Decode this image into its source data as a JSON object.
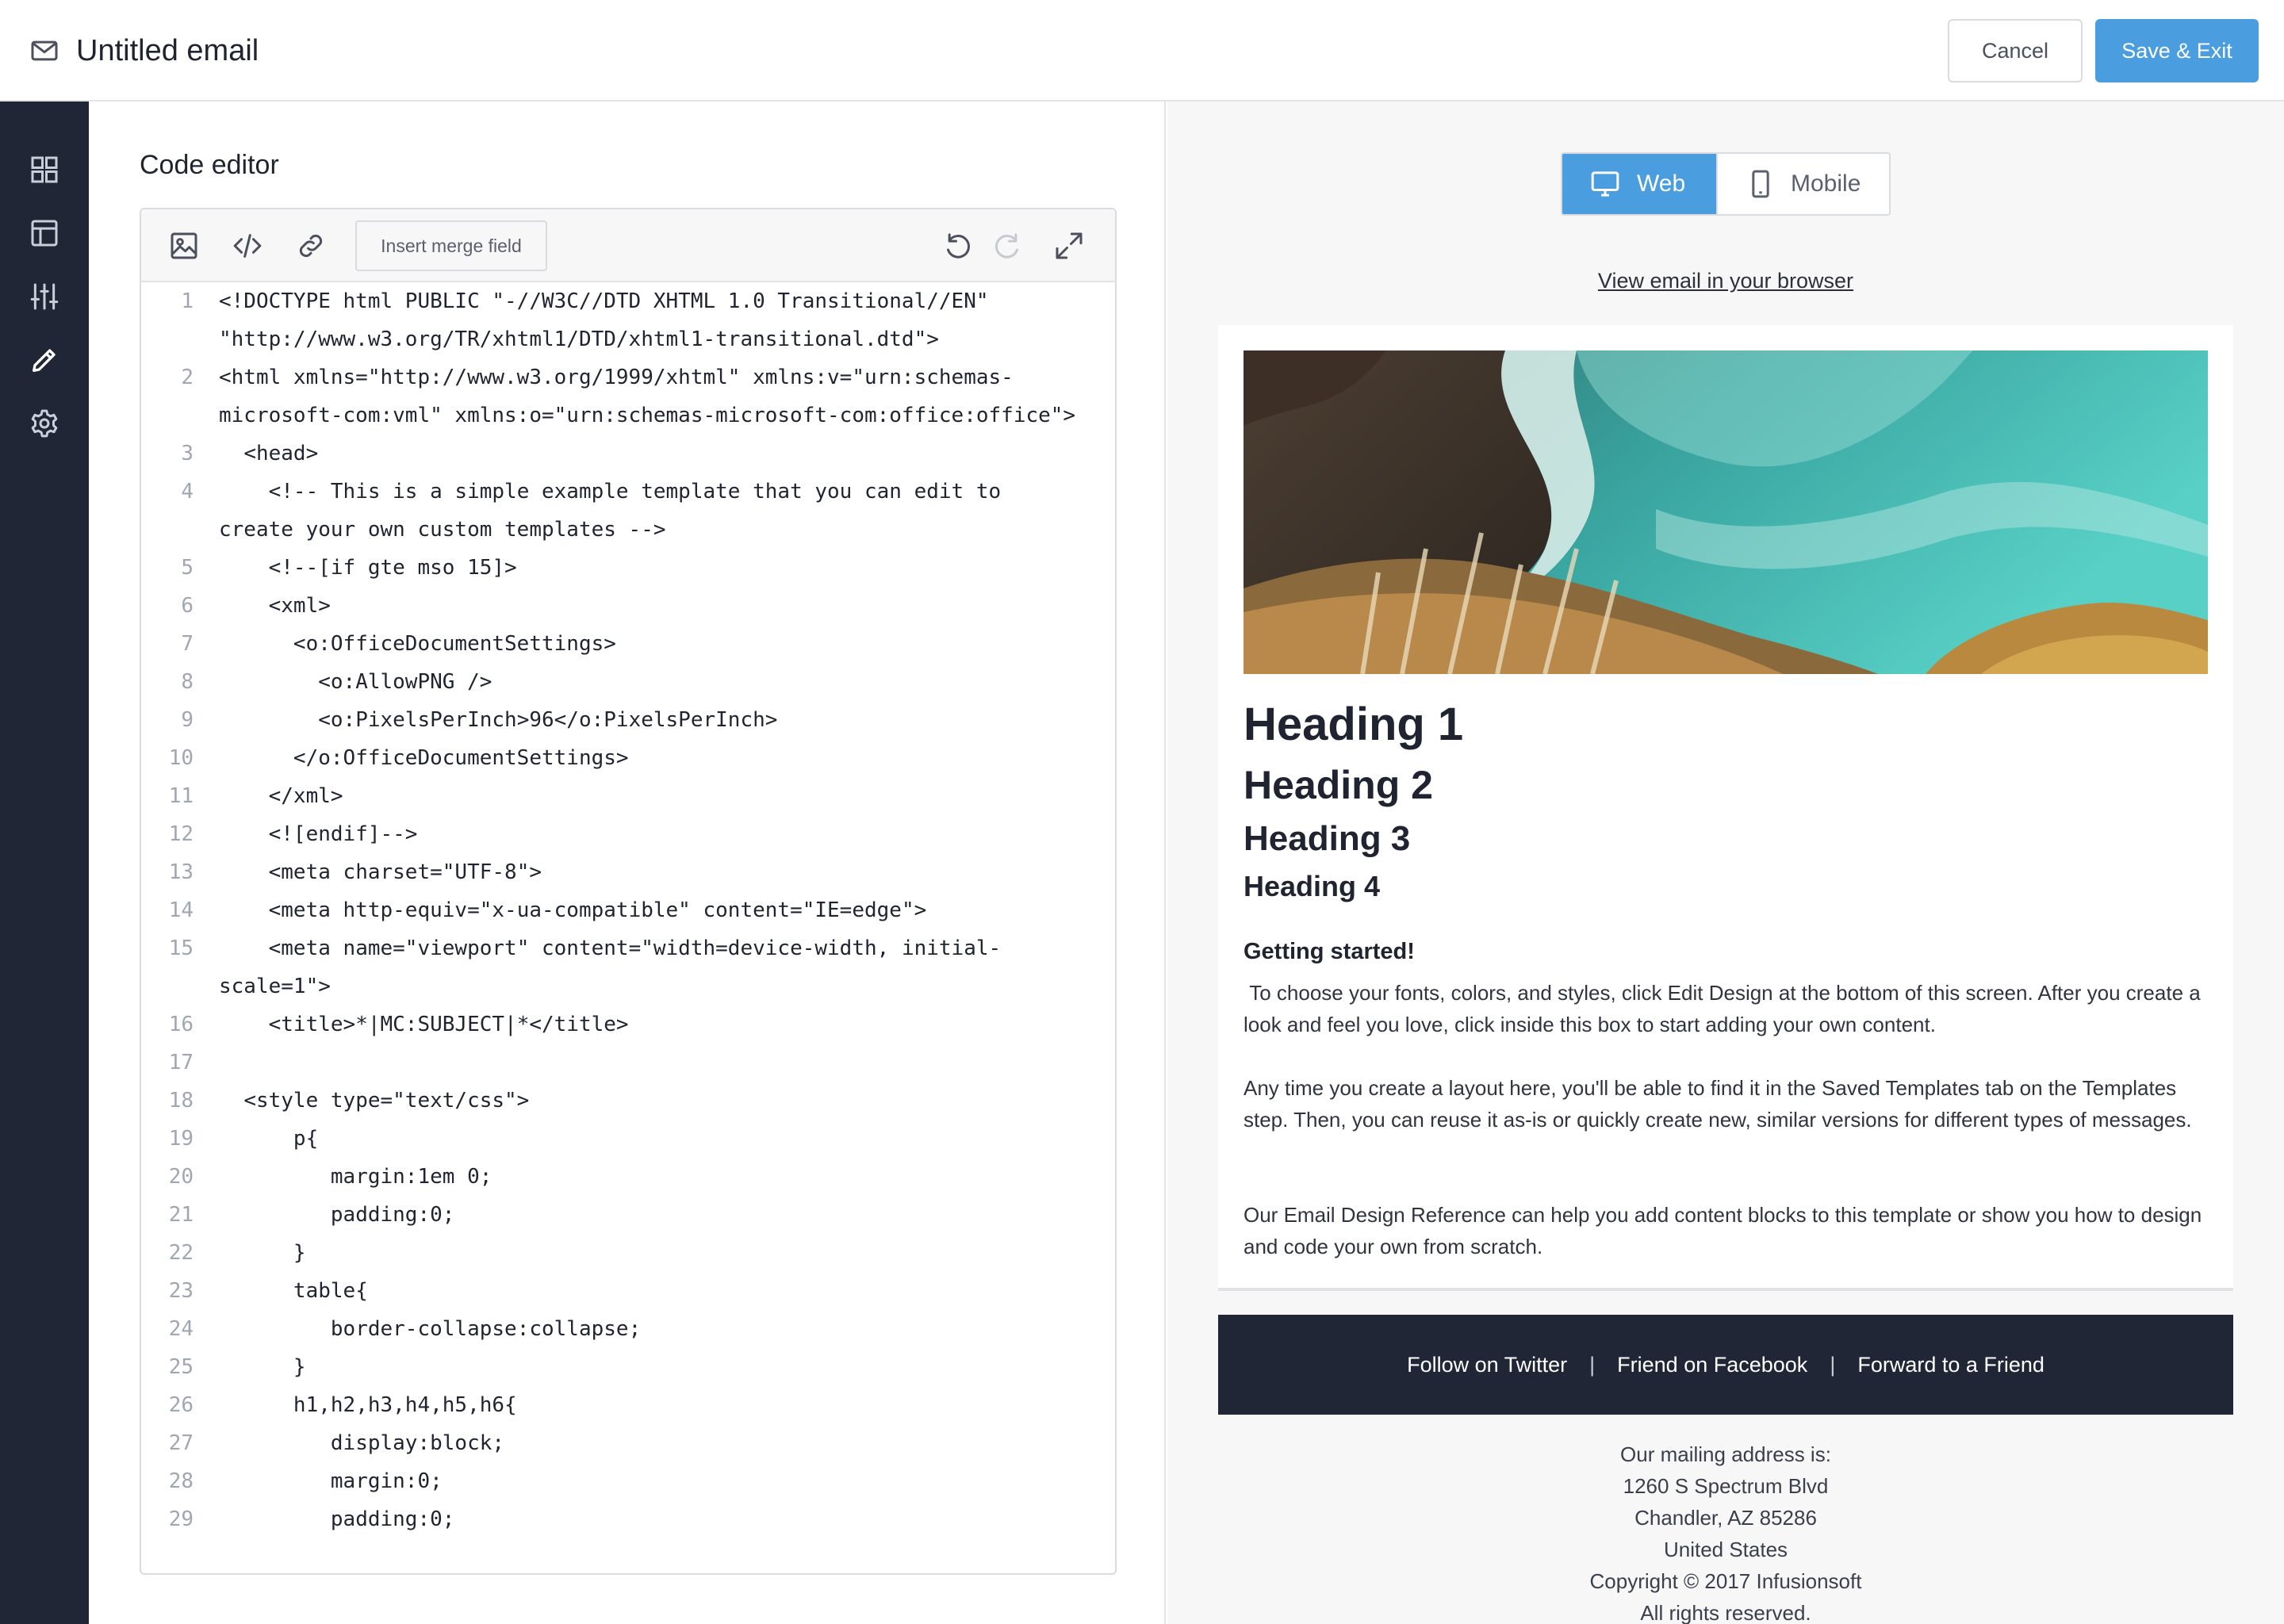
{
  "header": {
    "title": "Untitled email",
    "cancel_label": "Cancel",
    "save_label": "Save & Exit"
  },
  "sidebar": {
    "items": [
      {
        "icon": "grid-icon"
      },
      {
        "icon": "layout-icon"
      },
      {
        "icon": "sliders-icon"
      },
      {
        "icon": "pencil-icon",
        "active": true
      },
      {
        "icon": "gear-icon"
      }
    ]
  },
  "editor": {
    "title": "Code editor",
    "toolbar": {
      "merge_field_label": "Insert merge field",
      "icons": [
        "image-icon",
        "code-icon",
        "link-icon",
        "undo-icon",
        "redo-icon",
        "expand-icon"
      ]
    },
    "lines": [
      {
        "n": "1",
        "t": "<!DOCTYPE html PUBLIC \"-//W3C//DTD XHTML 1.0 Transitional//EN\" \"http://www.w3.org/TR/xhtml1/DTD/xhtml1-transitional.dtd\">"
      },
      {
        "n": "2",
        "t": "<html xmlns=\"http://www.w3.org/1999/xhtml\" xmlns:v=\"urn:schemas-microsoft-com:vml\" xmlns:o=\"urn:schemas-microsoft-com:office:office\">"
      },
      {
        "n": "3",
        "t": "  <head>"
      },
      {
        "n": "4",
        "t": "    <!-- This is a simple example template that you can edit to create your own custom templates -->"
      },
      {
        "n": "5",
        "t": "    <!--[if gte mso 15]>"
      },
      {
        "n": "6",
        "t": "    <xml>"
      },
      {
        "n": "7",
        "t": "      <o:OfficeDocumentSettings>"
      },
      {
        "n": "8",
        "t": "        <o:AllowPNG />"
      },
      {
        "n": "9",
        "t": "        <o:PixelsPerInch>96</o:PixelsPerInch>"
      },
      {
        "n": "10",
        "t": "      </o:OfficeDocumentSettings>"
      },
      {
        "n": "11",
        "t": "    </xml>"
      },
      {
        "n": "12",
        "t": "    <![endif]-->"
      },
      {
        "n": "13",
        "t": "    <meta charset=\"UTF-8\">"
      },
      {
        "n": "14",
        "t": "    <meta http-equiv=\"x-ua-compatible\" content=\"IE=edge\">"
      },
      {
        "n": "15",
        "t": "    <meta name=\"viewport\" content=\"width=device-width, initial-scale=1\">"
      },
      {
        "n": "16",
        "t": "    <title>*|MC:SUBJECT|*</title>"
      },
      {
        "n": "17",
        "t": ""
      },
      {
        "n": "18",
        "t": "  <style type=\"text/css\">"
      },
      {
        "n": "19",
        "t": "      p{"
      },
      {
        "n": "20",
        "t": "         margin:1em 0;"
      },
      {
        "n": "21",
        "t": "         padding:0;"
      },
      {
        "n": "22",
        "t": "      }"
      },
      {
        "n": "23",
        "t": "      table{"
      },
      {
        "n": "24",
        "t": "         border-collapse:collapse;"
      },
      {
        "n": "25",
        "t": "      }"
      },
      {
        "n": "26",
        "t": "      h1,h2,h3,h4,h5,h6{"
      },
      {
        "n": "27",
        "t": "         display:block;"
      },
      {
        "n": "28",
        "t": "         margin:0;"
      },
      {
        "n": "29",
        "t": "         padding:0;"
      }
    ]
  },
  "preview": {
    "web_label": "Web",
    "mobile_label": "Mobile",
    "view_link": "View email in your browser",
    "heading1": "Heading 1",
    "heading2": "Heading 2",
    "heading3": "Heading 3",
    "heading4": "Heading 4",
    "getting_started": "Getting started!",
    "para1": " To choose your fonts, colors, and styles, click Edit Design at the bottom of this screen. After you create a look and feel you love, click inside this box to start adding your own content.",
    "para2": "Any time you create a layout here, you'll be able to find it in the Saved Templates tab on the Templates step. Then, you can reuse it as-is or quickly create new, similar versions for different types of messages.",
    "para3": "Our Email Design Reference can help you add content blocks to this template or show you how to design and code your own from scratch.",
    "footer_links": [
      "Follow on Twitter",
      "Friend on Facebook",
      "Forward to a Friend"
    ],
    "footer_separator": "|",
    "address": [
      "Our mailing address is:",
      "1260 S Spectrum Blvd",
      "Chandler, AZ  85286",
      "United States",
      "Copyright © 2017 Infusionsoft",
      "All rights reserved."
    ]
  },
  "colors": {
    "accent": "#4a9ee0",
    "sidebar": "#212637",
    "footer": "#212637"
  }
}
